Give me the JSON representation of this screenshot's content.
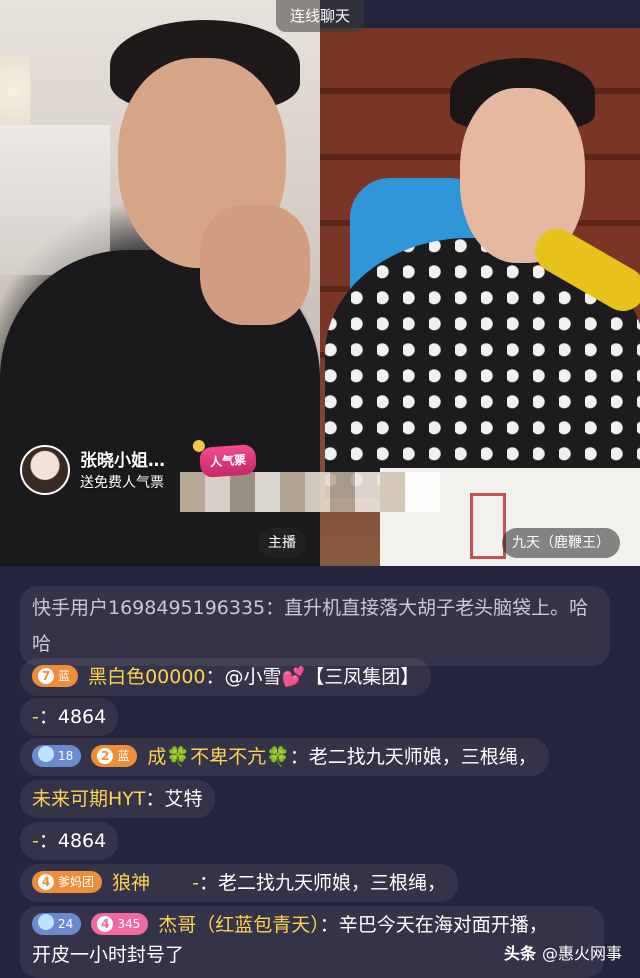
{
  "top_label": "连线聊天",
  "gift": {
    "user_name": "张晓小姐…",
    "action": "送免费人气票",
    "badge_text": "人气票"
  },
  "host_tag": "主播",
  "guest_tag": "九天（鹿鞭王）",
  "chat": {
    "m1_text": "快手用户1698495196335：直升机直接落大胡子老头脑袋上。哈哈",
    "m2": {
      "badge_level": "7",
      "badge_label": "蓝",
      "user": "黑白色00000",
      "text": "：@小雪",
      "heart": "💕",
      "tail": "【三凤集团】"
    },
    "m3": {
      "user": "-",
      "text": "：4864"
    },
    "m4": {
      "diamond_level": "18",
      "badge_level": "2",
      "badge_label": "蓝",
      "user_a": "成",
      "user_b": "不卑不亢",
      "clover": "🍀",
      "text": "：老二找九天师娘，三根绳，"
    },
    "m5": {
      "user": "未来可期HYT",
      "text": "：艾特"
    },
    "m6": {
      "user": "-",
      "text": "：4864"
    },
    "m7": {
      "badge_level": "4",
      "badge_label": "爹妈团",
      "user": "狼神",
      "user2": "-",
      "text": "：老二找九天师娘，三根绳，"
    },
    "m8": {
      "diamond_level": "24",
      "badge_level": "4",
      "badge_label": "345",
      "user": "杰哥（红蓝包青天）",
      "text": "：辛巴今天在海对面开播，",
      "text2": "开皮一小时封号了"
    }
  },
  "footer": {
    "brand": "头条",
    "account": "@惠火网事"
  }
}
